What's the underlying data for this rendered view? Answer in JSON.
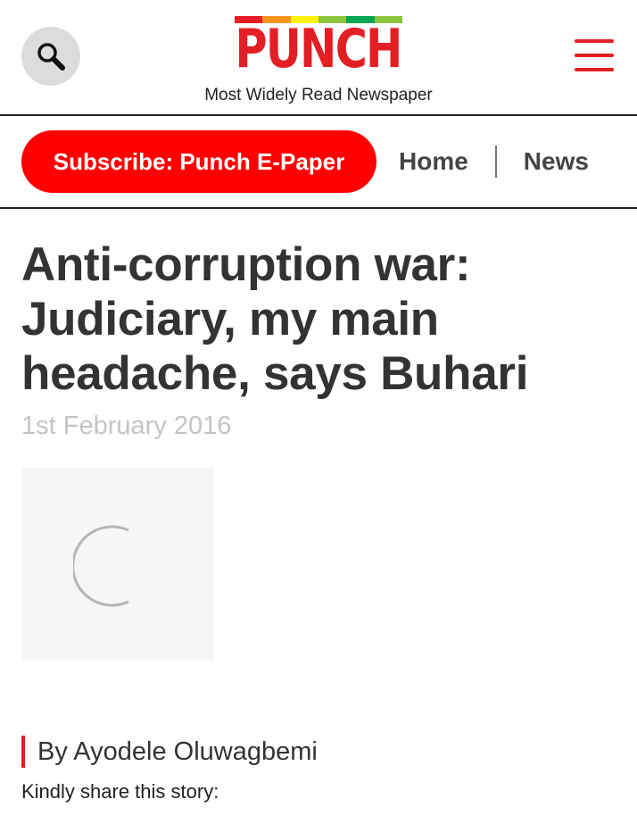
{
  "header": {
    "search_icon": "search-icon",
    "logo_text": "PUNCH",
    "logo_bar_colors": [
      "#e31e24",
      "#f7941d",
      "#fff200",
      "#8dc63f",
      "#00a651",
      "#8dc63f"
    ],
    "tagline": "Most Widely Read Newspaper",
    "menu_icon": "hamburger-menu-icon"
  },
  "nav": {
    "subscribe_label": "Subscribe: Punch E-Paper",
    "items": [
      {
        "label": "Home"
      },
      {
        "label": "News"
      }
    ]
  },
  "article": {
    "headline": "Anti-corruption war: Judiciary, my main headache, says Buhari",
    "date": "1st February 2016",
    "byline": "By Ayodele Oluwagbemi",
    "share_prompt": "Kindly share this story:"
  },
  "colors": {
    "brand_red": "#e31e24",
    "subscribe_red": "#ff0000",
    "text_dark": "#333333",
    "date_grey": "#c4c4c4",
    "search_bg": "#dcdcdc"
  }
}
